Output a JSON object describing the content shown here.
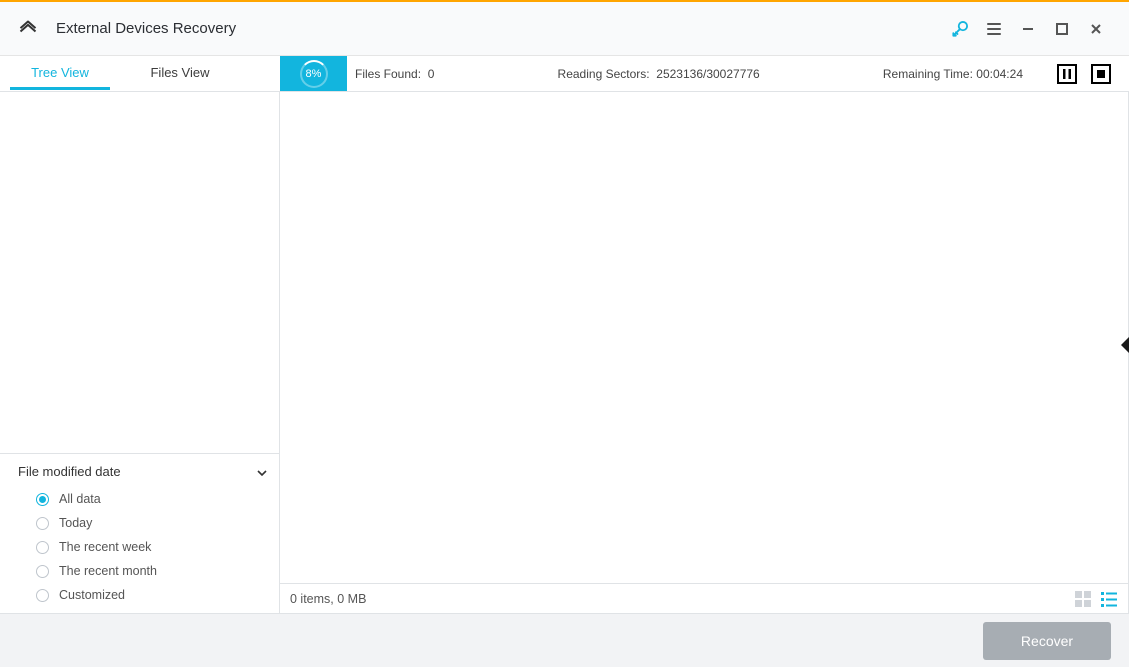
{
  "window": {
    "title": "External Devices Recovery"
  },
  "tabs": {
    "tree": "Tree View",
    "files": "Files View",
    "active": "tree"
  },
  "progress": {
    "percent_label": "8%"
  },
  "stats": {
    "files_found_label": "Files Found:",
    "files_found_value": "0",
    "reading_sectors_label": "Reading Sectors:",
    "reading_sectors_value": "2523136/30027776",
    "remaining_time_label": "Remaining Time:",
    "remaining_time_value": "00:04:24"
  },
  "filter": {
    "header": "File modified date",
    "options": [
      {
        "label": "All data",
        "selected": true
      },
      {
        "label": "Today",
        "selected": false
      },
      {
        "label": "The recent week",
        "selected": false
      },
      {
        "label": "The recent month",
        "selected": false
      },
      {
        "label": "Customized",
        "selected": false
      }
    ]
  },
  "status": {
    "text": "0 items, 0 MB"
  },
  "footer": {
    "recover_label": "Recover"
  },
  "colors": {
    "accent": "#12b5de",
    "top_border": "#ffa500"
  }
}
